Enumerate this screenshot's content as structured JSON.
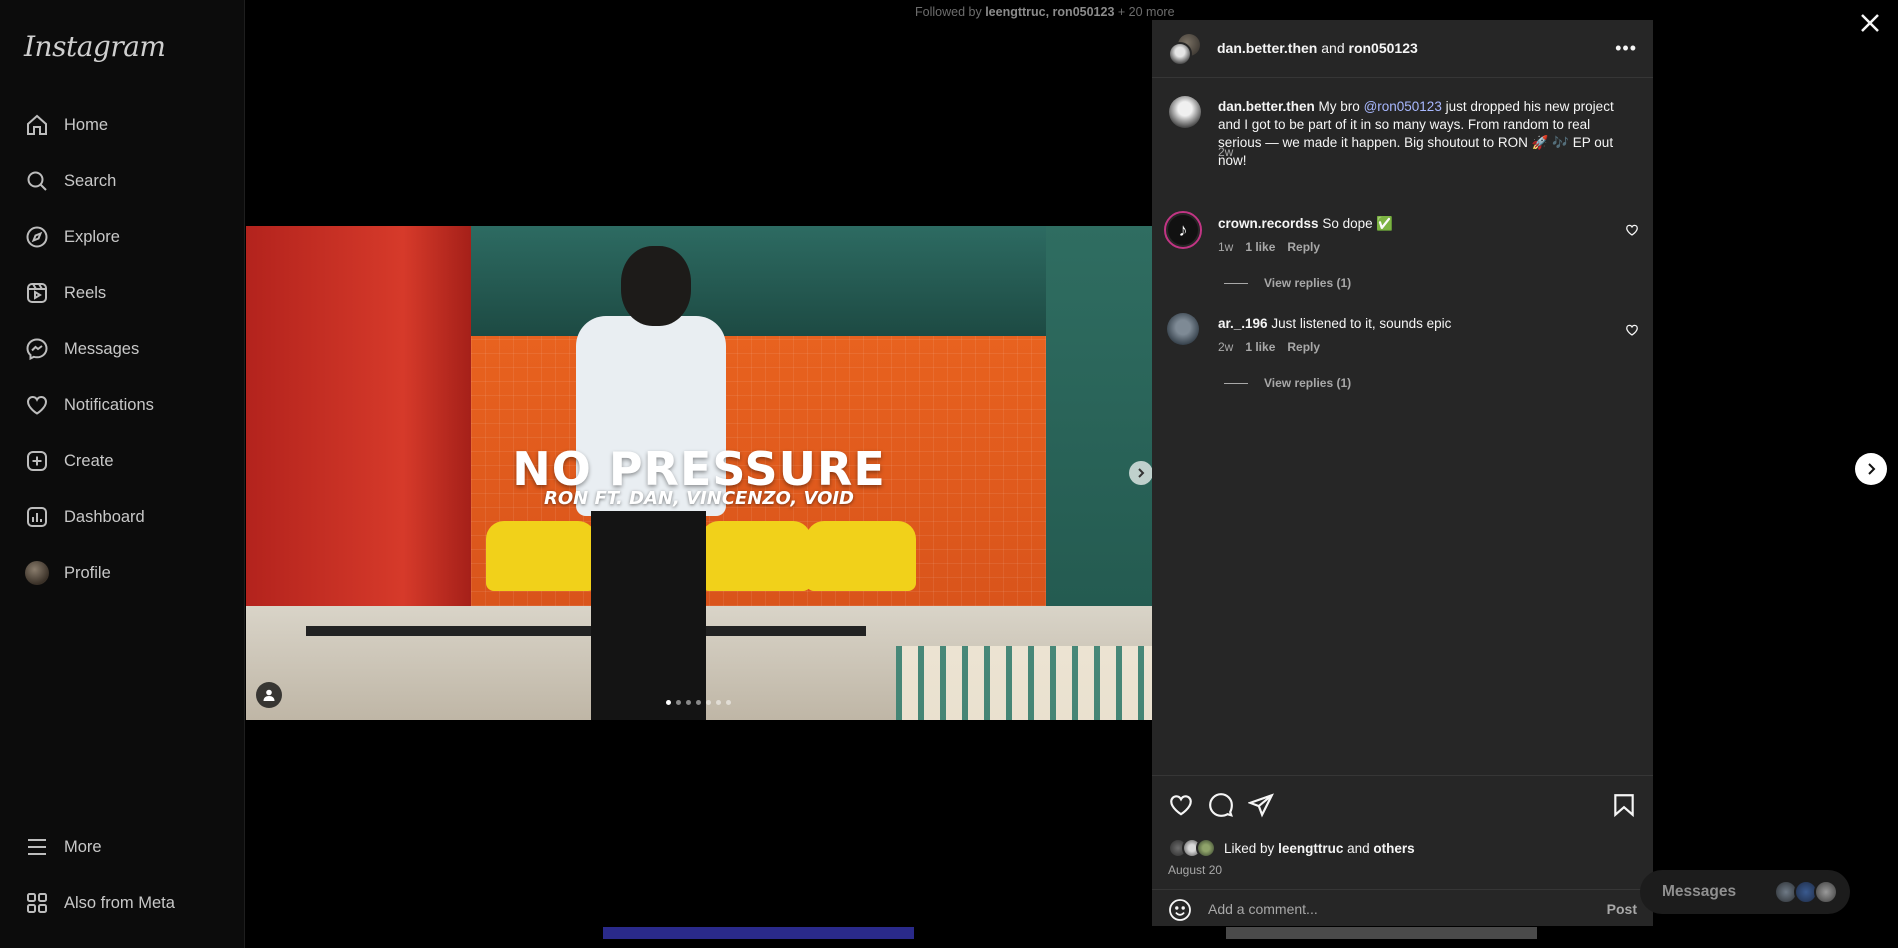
{
  "app": {
    "logo": "Instagram"
  },
  "sidebar": {
    "items": [
      {
        "label": "Home",
        "icon": "home-icon"
      },
      {
        "label": "Search",
        "icon": "search-icon"
      },
      {
        "label": "Explore",
        "icon": "compass-icon"
      },
      {
        "label": "Reels",
        "icon": "reels-icon"
      },
      {
        "label": "Messages",
        "icon": "messenger-icon"
      },
      {
        "label": "Notifications",
        "icon": "heart-icon"
      },
      {
        "label": "Create",
        "icon": "plus-square-icon"
      },
      {
        "label": "Dashboard",
        "icon": "dashboard-icon"
      },
      {
        "label": "Profile",
        "icon": "avatar"
      }
    ],
    "more": "More",
    "also_from_meta": "Also from Meta"
  },
  "followed_by": {
    "prefix": "Followed by",
    "names": "leengttruc, ron050123",
    "more": "+ 20 more"
  },
  "media": {
    "title": "NO PRESSURE",
    "subtitle": "RON FT. DAN, VINCENZO, VOID",
    "slide_count": 7,
    "active_slide": 1
  },
  "post": {
    "author": "dan.better.then",
    "and": "and",
    "collaborator": "ron050123",
    "caption": {
      "author": "dan.better.then",
      "text_before": "My bro",
      "mention": "@ron050123",
      "text_after": "just dropped his new project and I got to be part of it in so many ways. From random to real serious — we made it happen. Big shoutout to RON 🚀 🎶 EP out now!",
      "time": "2w"
    },
    "comments": [
      {
        "user": "crown.recordss",
        "text": "So dope ✅",
        "time": "1w",
        "likes": "1 like",
        "reply": "Reply",
        "view_replies": "View replies (1)"
      },
      {
        "user": "ar._.196",
        "text": "Just listened to it, sounds epic",
        "time": "2w",
        "likes": "1 like",
        "reply": "Reply",
        "view_replies": "View replies (1)"
      }
    ],
    "liked_by": {
      "prefix": "Liked by",
      "user": "leengttruc",
      "and": "and",
      "others": "others"
    },
    "date": "August 20",
    "comment_placeholder": "Add a comment...",
    "post_label": "Post"
  },
  "background": {
    "messages_label": "Messages"
  }
}
